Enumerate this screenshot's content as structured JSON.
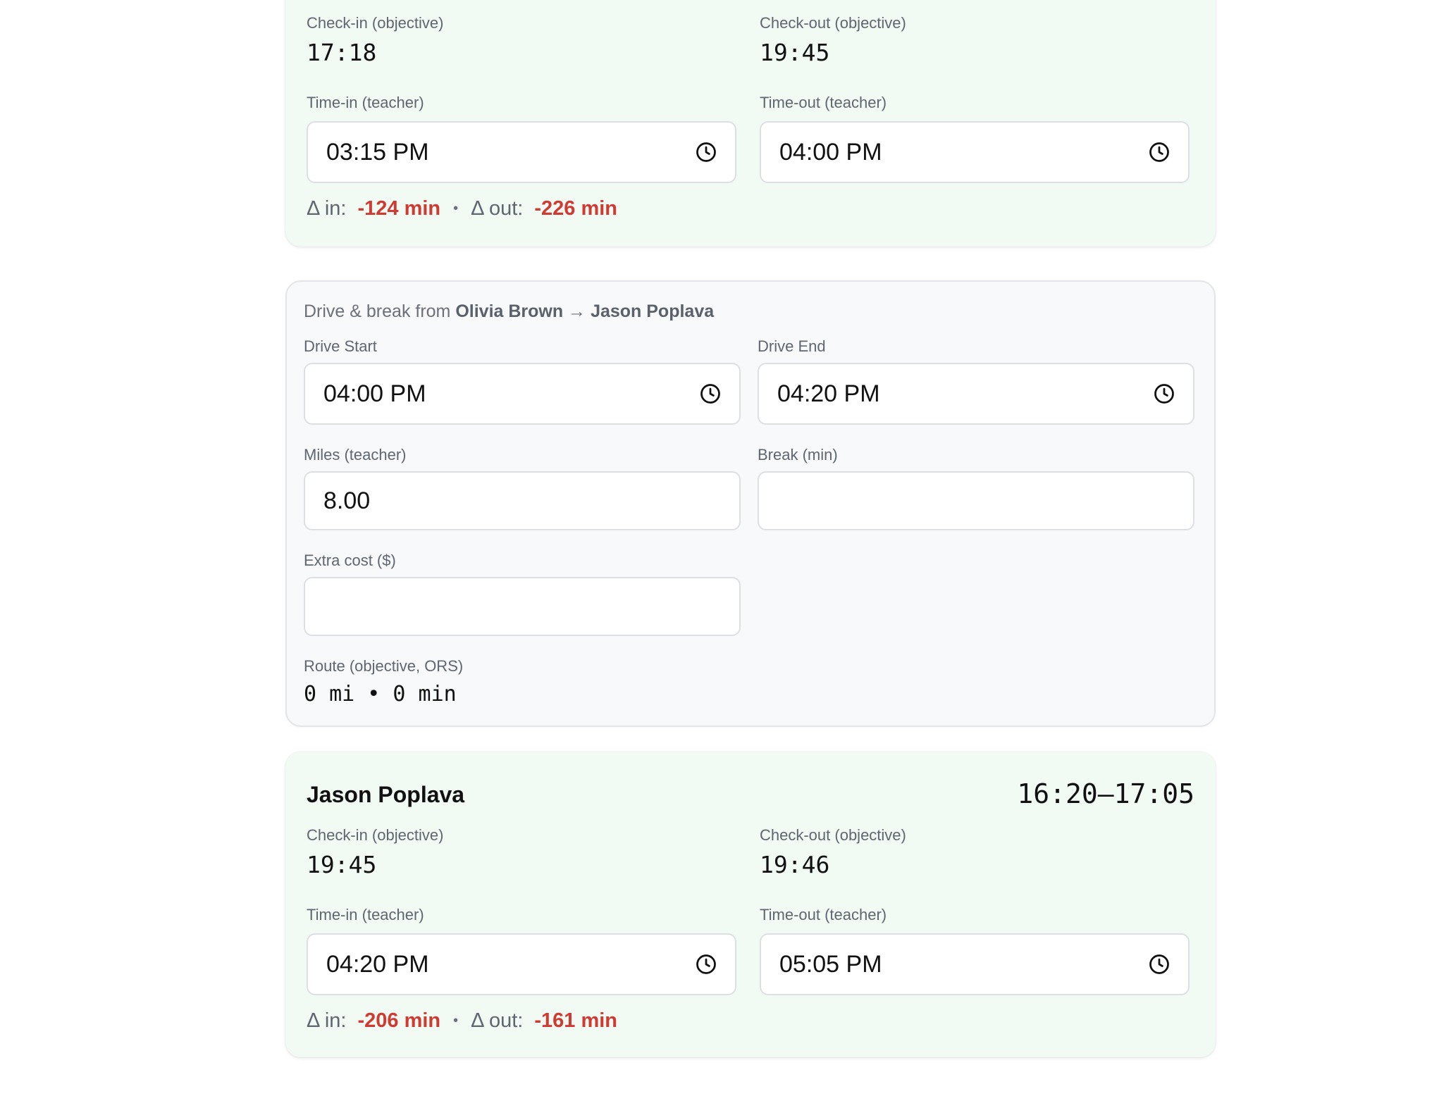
{
  "visit1": {
    "checkin_label": "Check-in (objective)",
    "checkin_value": "17:18",
    "checkout_label": "Check-out (objective)",
    "checkout_value": "19:45",
    "timein_label": "Time-in (teacher)",
    "timein_value": "03:15 PM",
    "timeout_label": "Time-out (teacher)",
    "timeout_value": "04:00 PM",
    "delta_in_label": "Δ in:",
    "delta_in_value": "-124 min",
    "delta_sep": "•",
    "delta_out_label": "Δ out:",
    "delta_out_value": "-226 min"
  },
  "drive": {
    "header_prefix": "Drive & break from",
    "from_name": "Olivia Brown",
    "arrow": "→",
    "to_name": "Jason Poplava",
    "drive_start_label": "Drive Start",
    "drive_start_value": "04:00 PM",
    "drive_end_label": "Drive End",
    "drive_end_value": "04:20 PM",
    "miles_label": "Miles (teacher)",
    "miles_value": "8.00",
    "break_label": "Break (min)",
    "break_value": "",
    "extra_cost_label": "Extra cost ($)",
    "extra_cost_value": "",
    "route_label": "Route (objective, ORS)",
    "route_value": "0 mi • 0 min"
  },
  "visit2": {
    "name": "Jason Poplava",
    "time_range": "16:20–17:05",
    "checkin_label": "Check-in (objective)",
    "checkin_value": "19:45",
    "checkout_label": "Check-out (objective)",
    "checkout_value": "19:46",
    "timein_label": "Time-in (teacher)",
    "timein_value": "04:20 PM",
    "timeout_label": "Time-out (teacher)",
    "timeout_value": "05:05 PM",
    "delta_in_label": "Δ in:",
    "delta_in_value": "-206 min",
    "delta_sep": "•",
    "delta_out_label": "Δ out:",
    "delta_out_value": "-161 min"
  },
  "icons": {
    "clock": "clock-icon"
  },
  "colors": {
    "card_green_bg": "#f1faf3",
    "card_gray_bg": "#f8f9fa",
    "delta_negative": "#cf3a32"
  }
}
